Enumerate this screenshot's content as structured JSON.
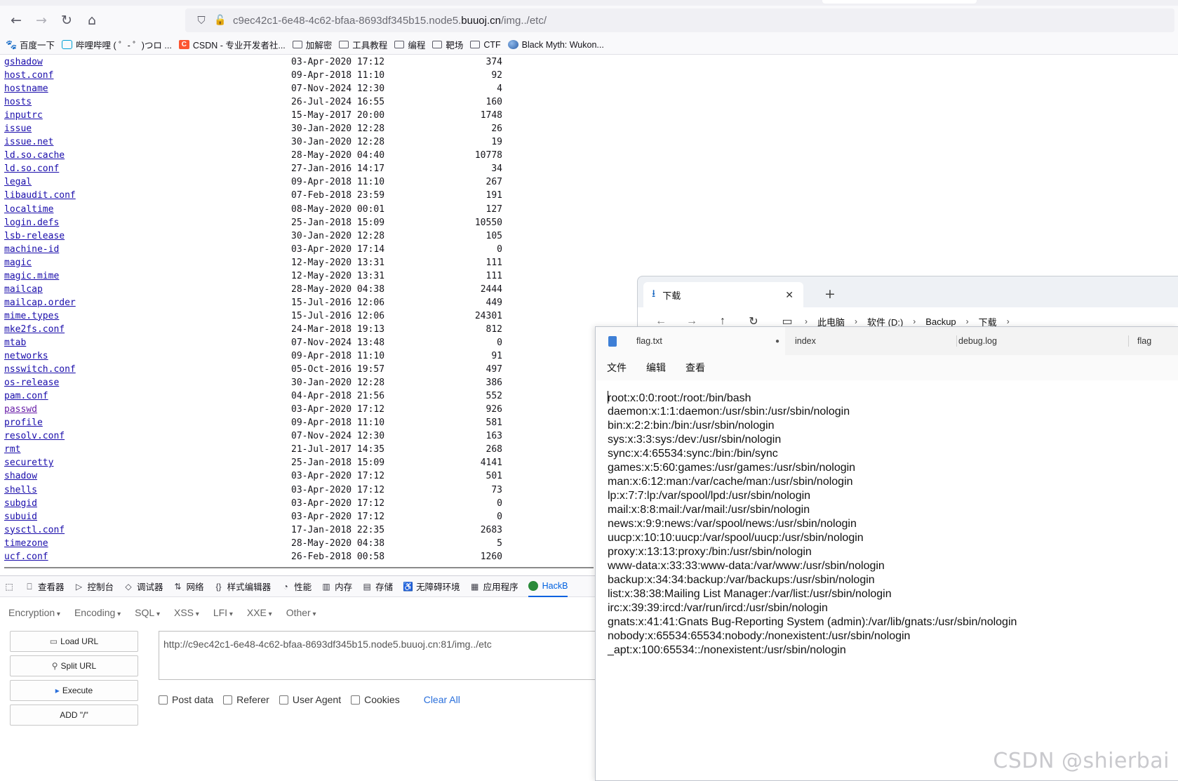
{
  "browser": {
    "url_prefix": "c9ec42c1-6e48-4c62-bfaa-8693df345b15.node5.",
    "url_domain": "buuoj.cn",
    "url_suffix": "/img../etc/",
    "nav": {
      "back": "←",
      "forward": "→",
      "reload": "↻",
      "home": "⌂",
      "shield": "⛉",
      "lock": "🔓"
    }
  },
  "bookmarks": [
    {
      "label": "百度一下",
      "icon": "baidu-icon"
    },
    {
      "label": "哔哩哔哩 ( ゜- ゜)つロ ...",
      "icon": "bilibili-icon"
    },
    {
      "label": "CSDN - 专业开发者社...",
      "icon": "csdn-icon"
    },
    {
      "label": "加解密",
      "icon": "folder-icon"
    },
    {
      "label": "工具教程",
      "icon": "folder-icon"
    },
    {
      "label": "编程",
      "icon": "folder-icon"
    },
    {
      "label": "靶场",
      "icon": "folder-icon"
    },
    {
      "label": "CTF",
      "icon": "folder-icon"
    },
    {
      "label": "Black Myth: Wukon...",
      "icon": "globe-icon"
    }
  ],
  "listing": [
    {
      "name": "gshadow",
      "date": "03-Apr-2020 17:12",
      "size": "374"
    },
    {
      "name": "host.conf",
      "date": "09-Apr-2018 11:10",
      "size": "92"
    },
    {
      "name": "hostname",
      "date": "07-Nov-2024 12:30",
      "size": "4"
    },
    {
      "name": "hosts",
      "date": "26-Jul-2024 16:55",
      "size": "160"
    },
    {
      "name": "inputrc",
      "date": "15-May-2017 20:00",
      "size": "1748"
    },
    {
      "name": "issue",
      "date": "30-Jan-2020 12:28",
      "size": "26"
    },
    {
      "name": "issue.net",
      "date": "30-Jan-2020 12:28",
      "size": "19"
    },
    {
      "name": "ld.so.cache",
      "date": "28-May-2020 04:40",
      "size": "10778"
    },
    {
      "name": "ld.so.conf",
      "date": "27-Jan-2016 14:17",
      "size": "34"
    },
    {
      "name": "legal",
      "date": "09-Apr-2018 11:10",
      "size": "267"
    },
    {
      "name": "libaudit.conf",
      "date": "07-Feb-2018 23:59",
      "size": "191"
    },
    {
      "name": "localtime",
      "date": "08-May-2020 00:01",
      "size": "127"
    },
    {
      "name": "login.defs",
      "date": "25-Jan-2018 15:09",
      "size": "10550"
    },
    {
      "name": "lsb-release",
      "date": "30-Jan-2020 12:28",
      "size": "105"
    },
    {
      "name": "machine-id",
      "date": "03-Apr-2020 17:14",
      "size": "0"
    },
    {
      "name": "magic",
      "date": "12-May-2020 13:31",
      "size": "111"
    },
    {
      "name": "magic.mime",
      "date": "12-May-2020 13:31",
      "size": "111"
    },
    {
      "name": "mailcap",
      "date": "28-May-2020 04:38",
      "size": "2444"
    },
    {
      "name": "mailcap.order",
      "date": "15-Jul-2016 12:06",
      "size": "449"
    },
    {
      "name": "mime.types",
      "date": "15-Jul-2016 12:06",
      "size": "24301"
    },
    {
      "name": "mke2fs.conf",
      "date": "24-Mar-2018 19:13",
      "size": "812"
    },
    {
      "name": "mtab",
      "date": "07-Nov-2024 13:48",
      "size": "0"
    },
    {
      "name": "networks",
      "date": "09-Apr-2018 11:10",
      "size": "91"
    },
    {
      "name": "nsswitch.conf",
      "date": "05-Oct-2016 19:57",
      "size": "497"
    },
    {
      "name": "os-release",
      "date": "30-Jan-2020 12:28",
      "size": "386"
    },
    {
      "name": "pam.conf",
      "date": "04-Apr-2018 21:56",
      "size": "552"
    },
    {
      "name": "passwd",
      "date": "03-Apr-2020 17:12",
      "size": "926",
      "visited": true
    },
    {
      "name": "profile",
      "date": "09-Apr-2018 11:10",
      "size": "581"
    },
    {
      "name": "resolv.conf",
      "date": "07-Nov-2024 12:30",
      "size": "163"
    },
    {
      "name": "rmt",
      "date": "21-Jul-2017 14:35",
      "size": "268"
    },
    {
      "name": "securetty",
      "date": "25-Jan-2018 15:09",
      "size": "4141"
    },
    {
      "name": "shadow",
      "date": "03-Apr-2020 17:12",
      "size": "501"
    },
    {
      "name": "shells",
      "date": "03-Apr-2020 17:12",
      "size": "73"
    },
    {
      "name": "subgid",
      "date": "03-Apr-2020 17:12",
      "size": "0"
    },
    {
      "name": "subuid",
      "date": "03-Apr-2020 17:12",
      "size": "0"
    },
    {
      "name": "sysctl.conf",
      "date": "17-Jan-2018 22:35",
      "size": "2683"
    },
    {
      "name": "timezone",
      "date": "28-May-2020 04:38",
      "size": "5"
    },
    {
      "name": "ucf.conf",
      "date": "26-Feb-2018 00:58",
      "size": "1260"
    }
  ],
  "devtools": {
    "tabs": [
      {
        "label": "查看器",
        "icon": "inspector-icon",
        "glyph": "⎕"
      },
      {
        "label": "控制台",
        "icon": "console-icon",
        "glyph": "▷"
      },
      {
        "label": "调试器",
        "icon": "debugger-icon",
        "glyph": "◇"
      },
      {
        "label": "网络",
        "icon": "network-icon",
        "glyph": "⇅"
      },
      {
        "label": "样式编辑器",
        "icon": "style-editor-icon",
        "glyph": "{}"
      },
      {
        "label": "性能",
        "icon": "performance-icon",
        "glyph": "◔"
      },
      {
        "label": "内存",
        "icon": "memory-icon",
        "glyph": "▥"
      },
      {
        "label": "存储",
        "icon": "storage-icon",
        "glyph": "▤"
      },
      {
        "label": "无障碍环境",
        "icon": "accessibility-icon",
        "glyph": "♿"
      },
      {
        "label": "应用程序",
        "icon": "application-icon",
        "glyph": "▦"
      }
    ],
    "active_tab": "HackB",
    "hackbar": {
      "menus": [
        "Encryption",
        "Encoding",
        "SQL",
        "XSS",
        "LFI",
        "XXE",
        "Other"
      ],
      "buttons": {
        "load": "Load URL",
        "split": "Split URL",
        "execute": "Execute",
        "add": "ADD \"/\""
      },
      "url_value": "http://c9ec42c1-6e48-4c62-bfaa-8693df345b15.node5.buuoj.cn:81/img../etc",
      "options": [
        "Post data",
        "Referer",
        "User Agent",
        "Cookies"
      ],
      "clear_all": "Clear All"
    }
  },
  "explorer": {
    "tab_title": "下载",
    "breadcrumb": [
      "此电脑",
      "软件 (D:)",
      "Backup",
      "下载"
    ]
  },
  "notepad": {
    "tabs": [
      "flag.txt",
      "index",
      "debug.log",
      "flag"
    ],
    "menu": [
      "文件",
      "编辑",
      "查看"
    ],
    "lines": [
      "root:x:0:0:root:/root:/bin/bash",
      "daemon:x:1:1:daemon:/usr/sbin:/usr/sbin/nologin",
      "bin:x:2:2:bin:/bin:/usr/sbin/nologin",
      "sys:x:3:3:sys:/dev:/usr/sbin/nologin",
      "sync:x:4:65534:sync:/bin:/bin/sync",
      "games:x:5:60:games:/usr/games:/usr/sbin/nologin",
      "man:x:6:12:man:/var/cache/man:/usr/sbin/nologin",
      "lp:x:7:7:lp:/var/spool/lpd:/usr/sbin/nologin",
      "mail:x:8:8:mail:/var/mail:/usr/sbin/nologin",
      "news:x:9:9:news:/var/spool/news:/usr/sbin/nologin",
      "uucp:x:10:10:uucp:/var/spool/uucp:/usr/sbin/nologin",
      "proxy:x:13:13:proxy:/bin:/usr/sbin/nologin",
      "www-data:x:33:33:www-data:/var/www:/usr/sbin/nologin",
      "backup:x:34:34:backup:/var/backups:/usr/sbin/nologin",
      "list:x:38:38:Mailing List Manager:/var/list:/usr/sbin/nologin",
      "irc:x:39:39:ircd:/var/run/ircd:/usr/sbin/nologin",
      "gnats:x:41:41:Gnats Bug-Reporting System (admin):/var/lib/gnats:/usr/sbin/nologin",
      "nobody:x:65534:65534:nobody:/nonexistent:/usr/sbin/nologin",
      "_apt:x:100:65534::/nonexistent:/usr/sbin/nologin"
    ]
  },
  "watermark": "CSDN @shierbai"
}
